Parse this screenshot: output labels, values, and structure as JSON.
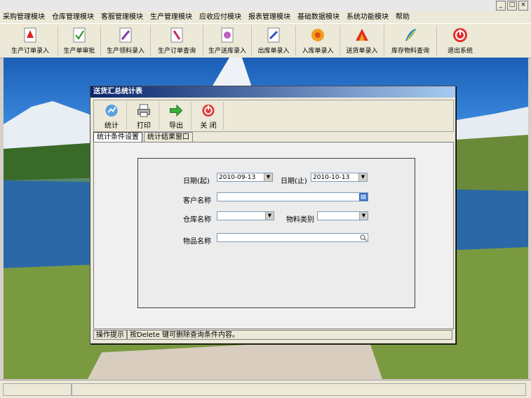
{
  "window": {
    "controls": [
      "_",
      "□",
      "×"
    ]
  },
  "menu": {
    "items": [
      "采购管理模块",
      "仓库管理模块",
      "客服管理模块",
      "生产管理模块",
      "应收应付模块",
      "报表管理模块",
      "基础数据模块",
      "系统功能模块",
      "帮助"
    ]
  },
  "toolbar": {
    "buttons": [
      {
        "label": "生产订单录入",
        "icon": "pdf-document-icon"
      },
      {
        "label": "生产单审批",
        "icon": "approve-doc-icon"
      },
      {
        "label": "生产领料录入",
        "icon": "material-doc-icon"
      },
      {
        "label": "生产订单查询",
        "icon": "query-doc-icon"
      },
      {
        "label": "生产送库录入",
        "icon": "delivery-doc-icon"
      },
      {
        "label": "出库单录入",
        "icon": "outbound-doc-icon"
      },
      {
        "label": "入库单录入",
        "icon": "flower-icon"
      },
      {
        "label": "送货单录入",
        "icon": "bird-icon"
      },
      {
        "label": "库存物料查询",
        "icon": "feather-icon"
      },
      {
        "label": "退出系统",
        "icon": "exit-icon"
      }
    ]
  },
  "dialog": {
    "title": "送货汇总统计表",
    "toolbar": {
      "stats": "统计",
      "print": "打印",
      "export": "导出",
      "close": "关 闭"
    },
    "tabs": [
      "统计条件设置",
      "统计结果窗口"
    ],
    "form": {
      "date_from_label": "日期(起)",
      "date_from_value": "2010-09-13",
      "date_to_label": "日期(止)",
      "date_to_value": "2010-10-13",
      "customer_label": "客户名称",
      "customer_value": "",
      "warehouse_label": "仓库名称",
      "warehouse_value": "",
      "material_type_label": "物料类别",
      "material_type_value": "",
      "item_label": "物品名称",
      "item_value": ""
    },
    "status": {
      "label": "操作提示",
      "hint": "按Delete 键可删除查询条件内容。"
    }
  }
}
